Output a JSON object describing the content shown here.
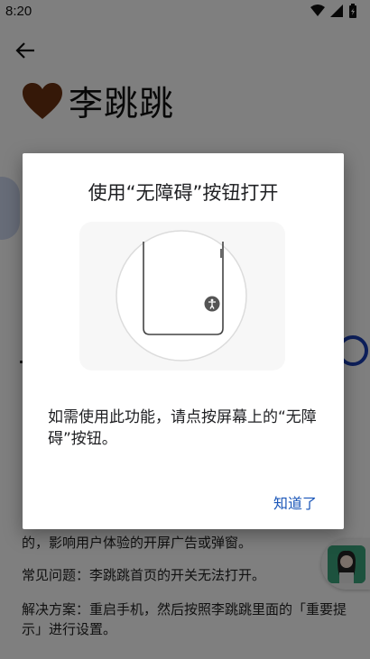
{
  "status_bar": {
    "time": "8:20",
    "icons": [
      "wifi-icon",
      "signal-icon",
      "battery-icon"
    ]
  },
  "app": {
    "title": "李跳跳",
    "title_icon": "heart-icon",
    "heart_color": "#6b3010",
    "back_icon": "arrow-back-icon",
    "paragraphs": [
      "的，影响用户体验的开屏广告或弹窗。",
      "常见问题：李跳跳首页的开关无法打开。",
      "解决方案：重启手机，然后按照李跳跳里面的「重要提示」进行设置。"
    ],
    "floating_bubble_icon": "avatar-icon"
  },
  "dialog": {
    "title": "使用“无障碍”按钮打开",
    "illustration_icon": "accessibility-icon",
    "message": "如需使用此功能，请点按屏幕上的“无障碍”按钮。",
    "ok_label": "知道了",
    "accent_color": "#1a56b8"
  }
}
